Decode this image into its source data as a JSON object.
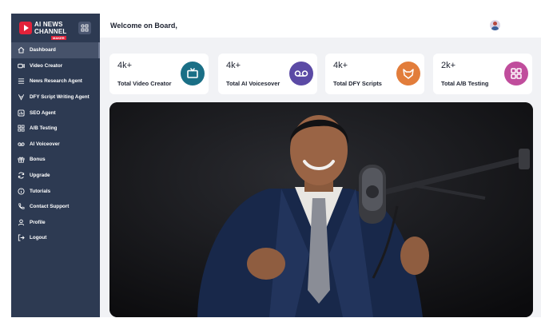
{
  "brand": {
    "line1": "AI NEWS",
    "line2": "CHANNEL",
    "tag": "MAKER"
  },
  "header": {
    "welcome": "Welcome on Board,"
  },
  "nav": [
    {
      "label": "Dashboard",
      "icon": "home-icon"
    },
    {
      "label": "Video Creator",
      "icon": "video-camera-icon"
    },
    {
      "label": "News Research Agent",
      "icon": "list-icon"
    },
    {
      "label": "DFY Script Writing Agent",
      "icon": "pen-icon"
    },
    {
      "label": "SEO Agent",
      "icon": "chart-icon"
    },
    {
      "label": "A/B Testing",
      "icon": "grid-icon"
    },
    {
      "label": "AI Voiceover",
      "icon": "voicemail-icon"
    },
    {
      "label": "Bonus",
      "icon": "gift-icon"
    },
    {
      "label": "Upgrade",
      "icon": "refresh-icon"
    },
    {
      "label": "Tutorials",
      "icon": "info-icon"
    },
    {
      "label": "Contact Support",
      "icon": "phone-icon"
    },
    {
      "label": "Profile",
      "icon": "user-icon"
    },
    {
      "label": "Logout",
      "icon": "logout-icon"
    }
  ],
  "stats": [
    {
      "value": "4k+",
      "label": "Total Video Creator",
      "icon": "tv-icon",
      "color": "#1a6f86"
    },
    {
      "value": "4k+",
      "label": "Total AI Voicesover",
      "icon": "voicemail-icon",
      "color": "#5b4aa5"
    },
    {
      "value": "4k+",
      "label": "Total DFY Scripts",
      "icon": "fox-icon",
      "color": "#e27d3b"
    },
    {
      "value": "2k+",
      "label": "Total A/B Testing",
      "icon": "grid-icon",
      "color": "#c04d9c"
    }
  ],
  "colors": {
    "sidebar": "#2d3a52",
    "sidebar_active": "#46526a",
    "background": "#f1f2f5"
  }
}
